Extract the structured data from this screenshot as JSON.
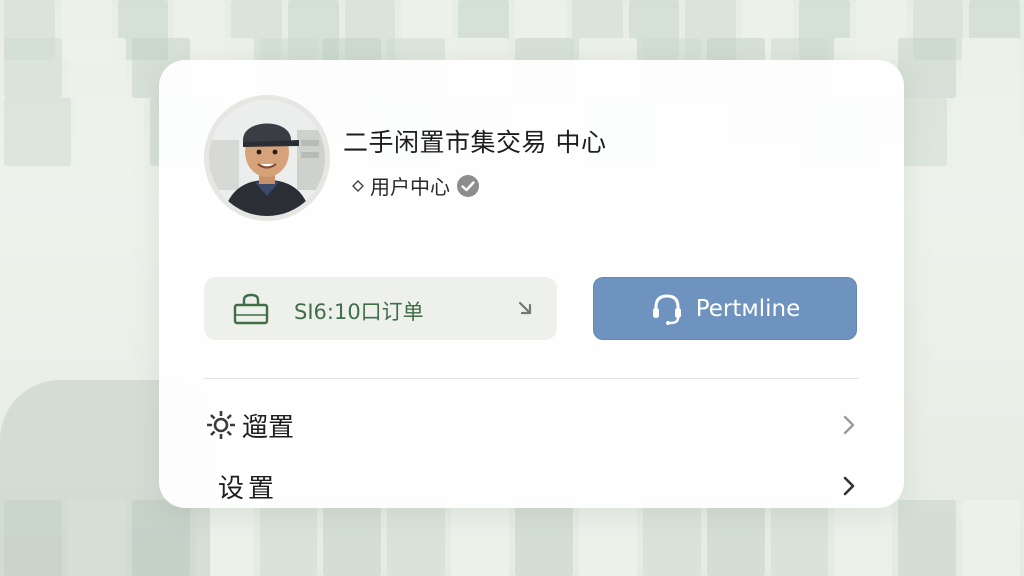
{
  "header": {
    "title": "二手闲置市集交易 中心",
    "subtitle": "用户中心"
  },
  "orders_button": {
    "label": "SI6:10口订单"
  },
  "service_button": {
    "label": "Pertмline"
  },
  "menu": {
    "items": [
      {
        "label": "遛置"
      },
      {
        "label": "设置"
      }
    ]
  },
  "icons": {
    "avatar": "user-avatar-photo",
    "subtitle_marker": "diamond-icon",
    "verified": "verified-check-icon",
    "orders": "shopping-bag-icon",
    "orders_arrow": "arrow-icon",
    "service": "headset-icon",
    "settings": "gear-icon",
    "chevron": "chevron-right-icon"
  },
  "colors": {
    "accent_green": "#3f6e47",
    "service_blue": "#6f93bf",
    "card_bg": "#ffffff",
    "orders_bg": "#eef0ec"
  }
}
